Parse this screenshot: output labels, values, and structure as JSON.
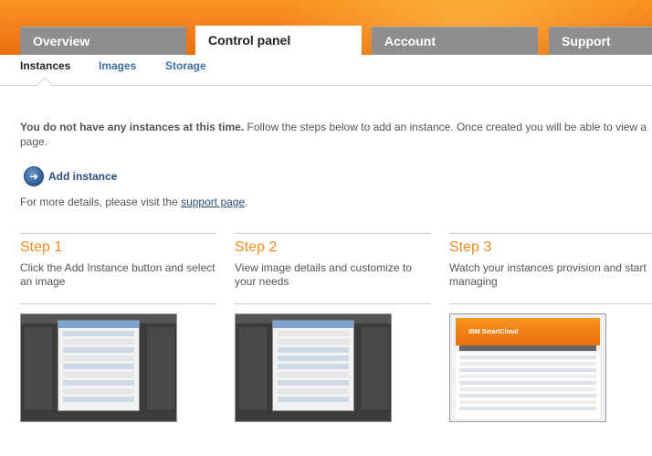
{
  "nav": {
    "tabs": [
      {
        "label": "Overview",
        "active": false
      },
      {
        "label": "Control panel",
        "active": true
      },
      {
        "label": "Account",
        "active": false
      },
      {
        "label": "Support",
        "active": false
      }
    ]
  },
  "subnav": {
    "tabs": [
      {
        "label": "Instances",
        "active": true
      },
      {
        "label": "Images",
        "active": false
      },
      {
        "label": "Storage",
        "active": false
      }
    ]
  },
  "main": {
    "intro_bold": "You do not have any instances at this time.",
    "intro_rest": " Follow the steps below to add an instance. Once created you will be able to view a",
    "intro_line2": "page.",
    "add_instance_label": "Add instance",
    "details_prefix": "For more details, please visit the ",
    "details_link": "support page",
    "details_suffix": "."
  },
  "steps": [
    {
      "title": "Step 1",
      "desc": "Click the Add Instance button and select an image"
    },
    {
      "title": "Step 2",
      "desc": "View image details and customize to your needs"
    },
    {
      "title": "Step 3",
      "desc": "Watch your instances provision and start managing"
    }
  ],
  "thumbnails": {
    "step3_brand": "IBM SmartCloud"
  },
  "colors": {
    "brand_orange": "#f58220",
    "tab_gray": "#8e8e8e",
    "link_blue": "#2b4f7c",
    "step_orange": "#f08a1d"
  }
}
